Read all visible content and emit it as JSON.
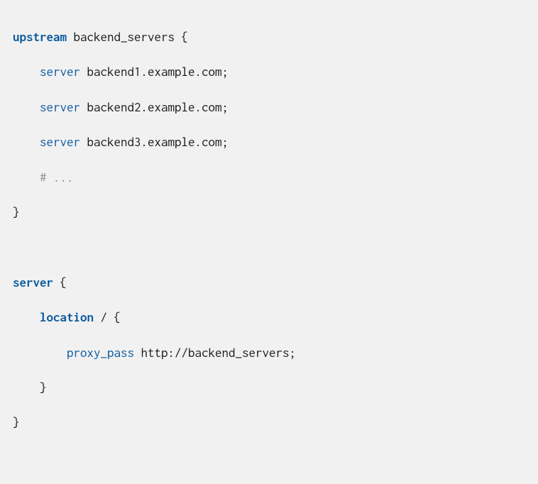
{
  "code": {
    "line1": {
      "kw": "upstream",
      "rest": " backend_servers {"
    },
    "line2": {
      "indent": "    ",
      "kw": "server",
      "rest": " backend1.example.com;"
    },
    "line3": {
      "indent": "    ",
      "kw": "server",
      "rest": " backend2.example.com;"
    },
    "line4": {
      "indent": "    ",
      "kw": "server",
      "rest": " backend3.example.com;"
    },
    "line5": {
      "indent": "    ",
      "comment": "# ..."
    },
    "line6": "}",
    "line7": "",
    "line8": {
      "kw": "server",
      "rest": " {"
    },
    "line9": {
      "indent": "    ",
      "kw": "location",
      "rest": " / {"
    },
    "line10": {
      "indent": "        ",
      "kw": "proxy_pass",
      "rest": " http://backend_servers;"
    },
    "line11": {
      "indent": "    ",
      "rest": "}"
    },
    "line12": "}"
  }
}
